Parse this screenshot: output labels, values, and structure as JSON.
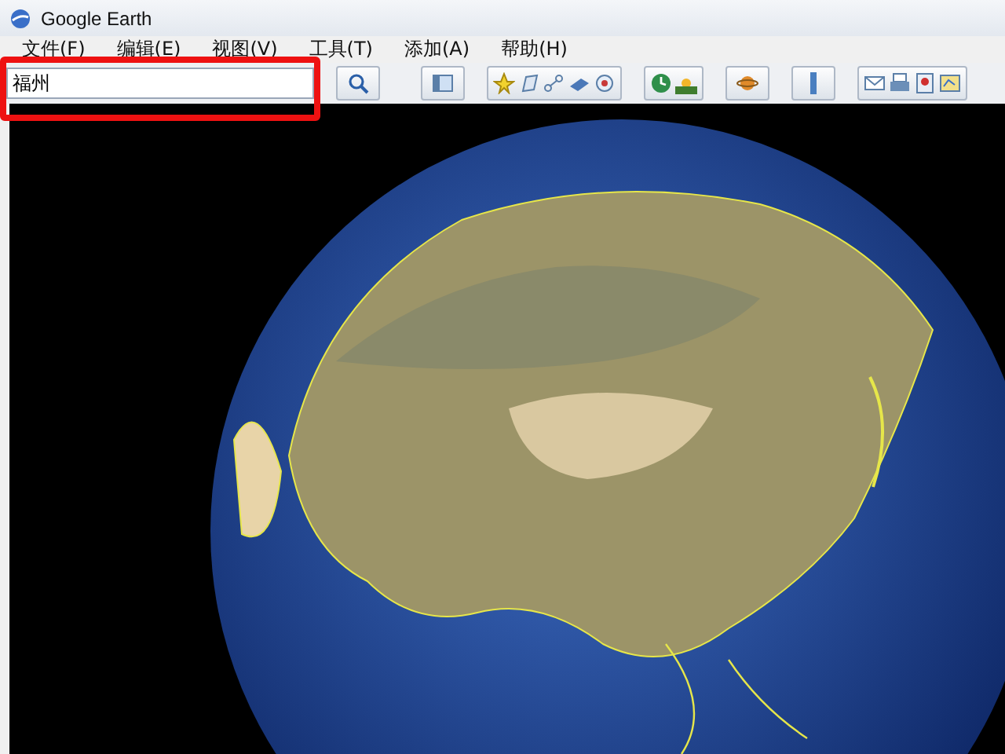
{
  "window": {
    "title": "Google Earth"
  },
  "menu": [
    {
      "label": "文件(F)"
    },
    {
      "label": "编辑(E)"
    },
    {
      "label": "视图(V)"
    },
    {
      "label": "工具(T)"
    },
    {
      "label": "添加(A)"
    },
    {
      "label": "帮助(H)"
    }
  ],
  "search": {
    "value": "福州"
  }
}
